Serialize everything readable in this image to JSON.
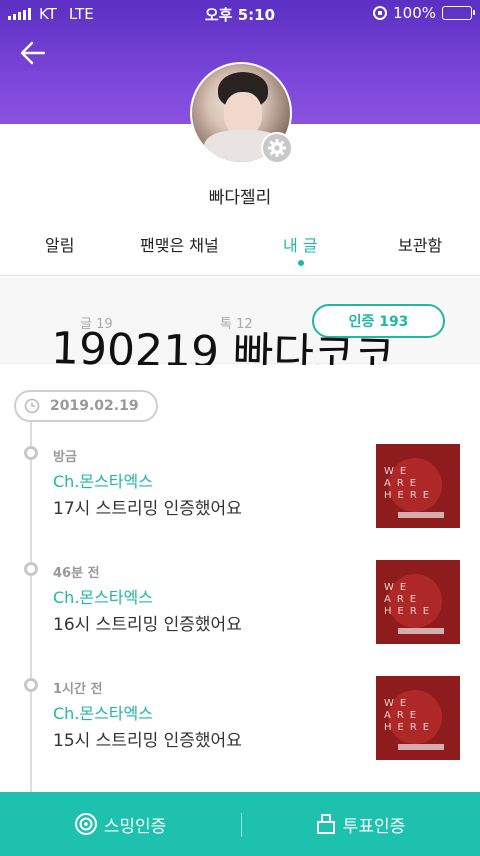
{
  "status_bar": {
    "carrier": "KT",
    "network": "LTE",
    "time": "오후 5:10",
    "battery": "100%",
    "battery_level": 1.0
  },
  "profile": {
    "username": "빠다젤리"
  },
  "tabs": [
    {
      "label": "알림"
    },
    {
      "label": "팬맺은 채널"
    },
    {
      "label": "내 글"
    },
    {
      "label": "보관함"
    }
  ],
  "stats": {
    "posts": "글 19",
    "talks": "톡 12",
    "cert_button": "인증 193"
  },
  "overlay_caption": "190219 빠다코코",
  "timeline": {
    "date": "2019.02.19",
    "posts": [
      {
        "time": "방금",
        "channel": "Ch.몬스타엑스",
        "text": "17시 스트리밍 인증했어요"
      },
      {
        "time": "46분 전",
        "channel": "Ch.몬스타엑스",
        "text": "16시 스트리밍 인증했어요"
      },
      {
        "time": "1시간 전",
        "channel": "Ch.몬스타엑스",
        "text": "15시 스트리밍 인증했어요"
      }
    ]
  },
  "bottom_bar": {
    "left_label": "스밍인증",
    "right_label": "투표인증"
  },
  "colors": {
    "header_purple": "#6a3ad0",
    "accent_teal": "#1fb8a6",
    "bottom_bar": "#1ec0ae"
  }
}
